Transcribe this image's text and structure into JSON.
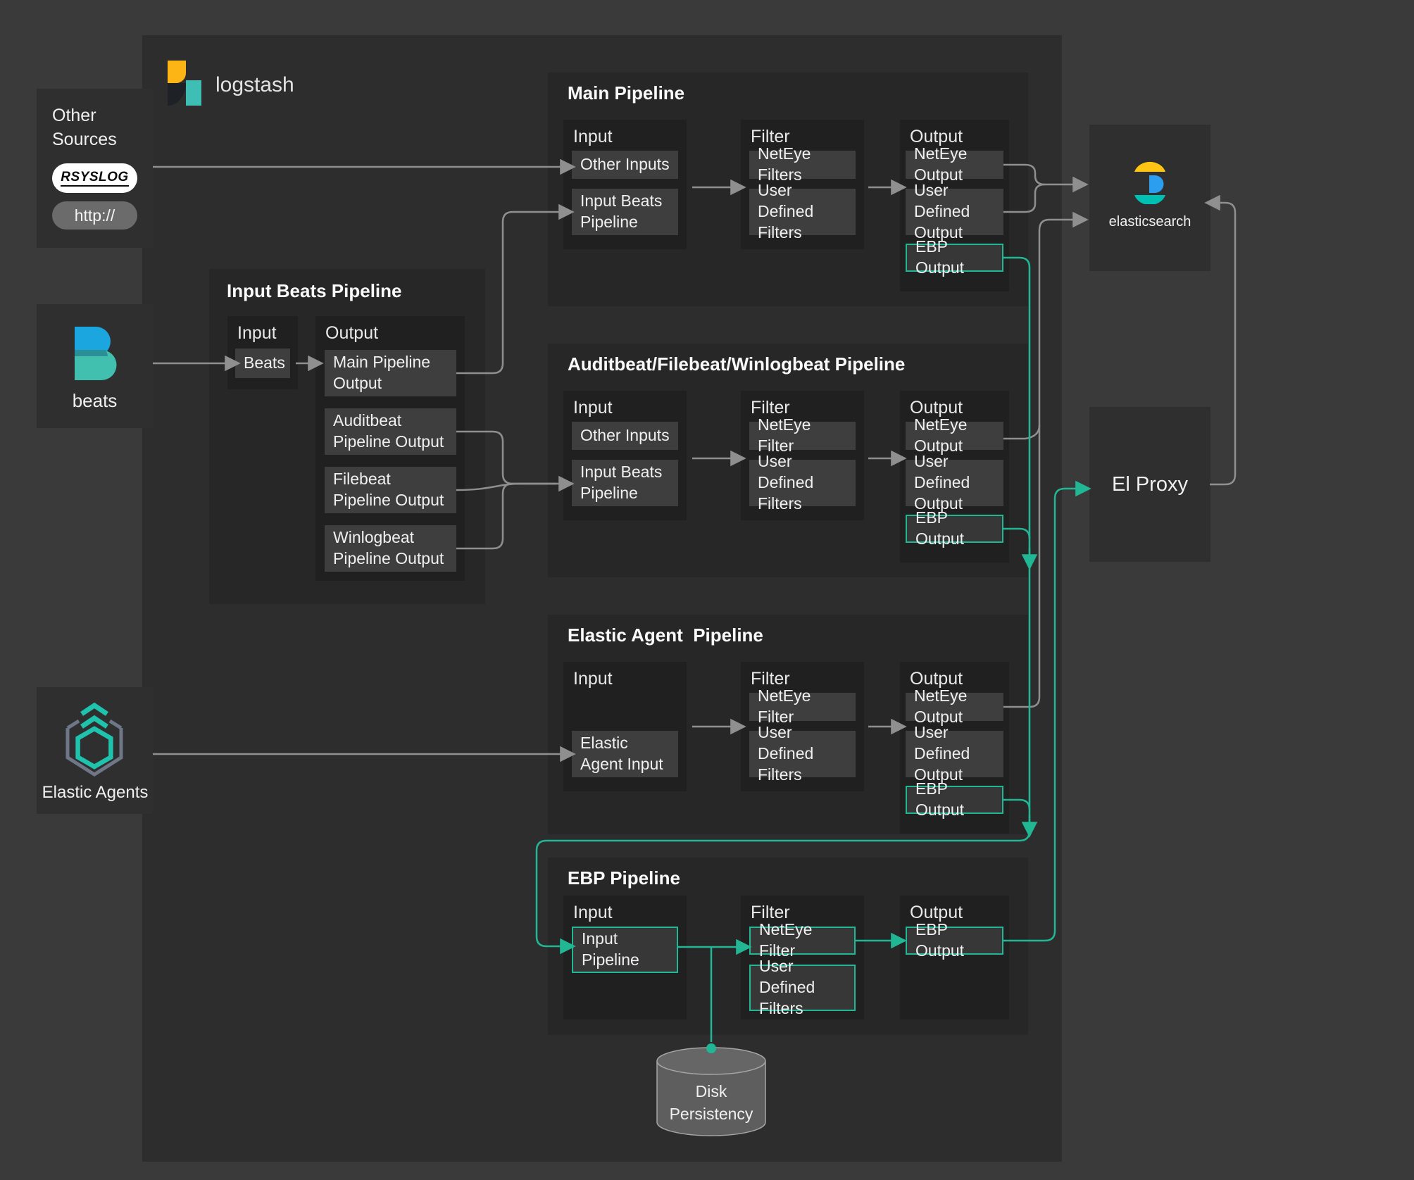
{
  "brand": {
    "name": "logstash"
  },
  "colors": {
    "teal": "#21b795",
    "arrow": "#8f8f8f",
    "logo_yellow": "#fdb515",
    "logo_teal": "#3ebeb4",
    "beats_blue": "#1ba6df",
    "beats_teal": "#41c0b0",
    "es_yellow": "#fec514",
    "es_blue": "#2b9ef0",
    "es_teal": "#00bfb3"
  },
  "left": {
    "other_sources": {
      "title": "Other Sources",
      "rsyslog_label": "rsyslog",
      "http_label": "http://"
    },
    "beats": {
      "label": "beats"
    },
    "elastic_agents": {
      "label": "Elastic Agents"
    }
  },
  "pipelines": {
    "input_beats": {
      "title": "Input Beats Pipeline",
      "input_header": "Input",
      "output_header": "Output",
      "input_items": [
        "Beats"
      ],
      "output_items": [
        "Main Pipeline Output",
        "Auditbeat Pipeline Output",
        "Filebeat Pipeline Output",
        "Winlogbeat Pipeline Output"
      ]
    },
    "main": {
      "title": "Main Pipeline",
      "input_header": "Input",
      "filter_header": "Filter",
      "output_header": "Output",
      "input_items": [
        "Other Inputs",
        "Input Beats Pipeline"
      ],
      "filter_items": [
        "NetEye Filters",
        "User Defined Filters"
      ],
      "output_items": [
        "NetEye Output",
        "User Defined Output",
        "EBP Output"
      ]
    },
    "abw": {
      "title": "Auditbeat/Filebeat/Winlogbeat Pipeline",
      "input_header": "Input",
      "filter_header": "Filter",
      "output_header": "Output",
      "input_items": [
        "Other Inputs",
        "Input Beats Pipeline"
      ],
      "filter_items": [
        "NetEye Filter",
        "User Defined Filters"
      ],
      "output_items": [
        "NetEye Output",
        "User Defined Output",
        "EBP Output"
      ]
    },
    "elastic_agent": {
      "title": "Elastic Agent  Pipeline",
      "input_header": "Input",
      "filter_header": "Filter",
      "output_header": "Output",
      "input_items": [
        "Elastic Agent Input"
      ],
      "filter_items": [
        "NetEye Filter",
        "User Defined Filters"
      ],
      "output_items": [
        "NetEye Output",
        "User Defined Output",
        "EBP Output"
      ]
    },
    "ebp": {
      "title": "EBP Pipeline",
      "input_header": "Input",
      "filter_header": "Filter",
      "output_header": "Output",
      "input_items": [
        "Input Pipeline"
      ],
      "filter_items": [
        "NetEye Filter",
        "User Defined Filters"
      ],
      "output_items": [
        "EBP Output"
      ]
    }
  },
  "right": {
    "elasticsearch": {
      "label": "elasticsearch"
    },
    "el_proxy": {
      "label": "El Proxy"
    }
  },
  "storage": {
    "disk": {
      "label": "Disk Persistency"
    }
  }
}
